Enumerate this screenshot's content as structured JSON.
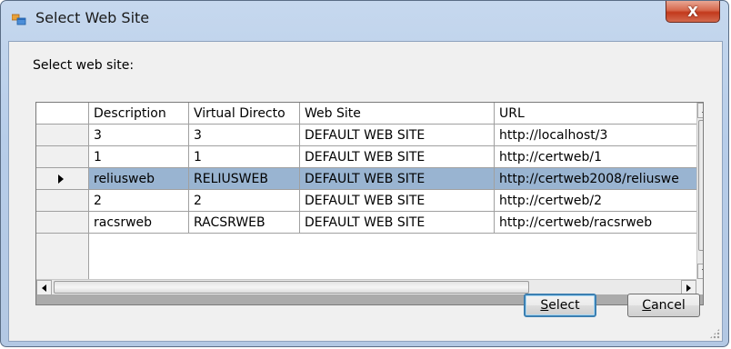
{
  "window": {
    "title": "Select Web Site",
    "close_glyph": "X",
    "icon": "app-window-icon"
  },
  "prompt": "Select web site:",
  "grid": {
    "columns": [
      "Description",
      "Virtual Directo",
      "Web Site",
      "URL"
    ],
    "rows": [
      {
        "description": "3",
        "virtual_directory": "3",
        "web_site": "DEFAULT WEB SITE",
        "url": "http://localhost/3",
        "selected": false
      },
      {
        "description": "1",
        "virtual_directory": "1",
        "web_site": "DEFAULT WEB SITE",
        "url": "http://certweb/1",
        "selected": false
      },
      {
        "description": "reliusweb",
        "virtual_directory": "RELIUSWEB",
        "web_site": "DEFAULT WEB SITE",
        "url": "http://certweb2008/reliuswe",
        "selected": true
      },
      {
        "description": "2",
        "virtual_directory": "2",
        "web_site": "DEFAULT WEB SITE",
        "url": "http://certweb/2",
        "selected": false
      },
      {
        "description": "racsrweb",
        "virtual_directory": "RACSRWEB",
        "web_site": "DEFAULT WEB SITE",
        "url": "http://certweb/racsrweb",
        "selected": false
      }
    ],
    "selection_color": "#99b4d1"
  },
  "buttons": {
    "select": {
      "mnemonic": "S",
      "rest": "elect"
    },
    "cancel": {
      "mnemonic": "C",
      "rest": "ancel"
    }
  }
}
